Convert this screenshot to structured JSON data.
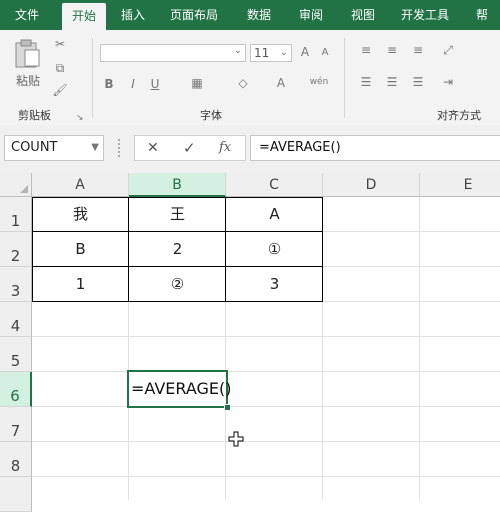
{
  "tabs": [
    "文件",
    "开始",
    "插入",
    "页面布局",
    "数据",
    "审阅",
    "视图",
    "开发工具",
    "帮"
  ],
  "ribbon": {
    "clipboard": {
      "paste_label": "粘贴",
      "group_label": "剪贴板"
    },
    "font": {
      "font_name": "",
      "font_size": "11",
      "group_label": "字体",
      "bold": "B",
      "italic": "I",
      "underline": "U",
      "phonetic": "wén"
    },
    "alignment": {
      "group_label": "对齐方式"
    }
  },
  "formula_bar": {
    "name_box": "COUNT",
    "cancel": "✕",
    "enter": "✓",
    "fx": "fx",
    "formula": "=AVERAGE()"
  },
  "grid": {
    "columns": [
      "A",
      "B",
      "C",
      "D",
      "E"
    ],
    "rows": [
      "1",
      "2",
      "3",
      "4",
      "5",
      "6",
      "7",
      "8"
    ],
    "cells": {
      "A1": "我",
      "B1": "王",
      "C1": "A",
      "A2": "B",
      "B2": "2",
      "C2": "①",
      "A3": "1",
      "B3": "②",
      "C3": "3"
    },
    "active_cell": {
      "ref": "B6",
      "value": "=AVERAGE()"
    }
  },
  "colors": {
    "accent": "#217346",
    "selected_header": "#d3f0e0"
  }
}
